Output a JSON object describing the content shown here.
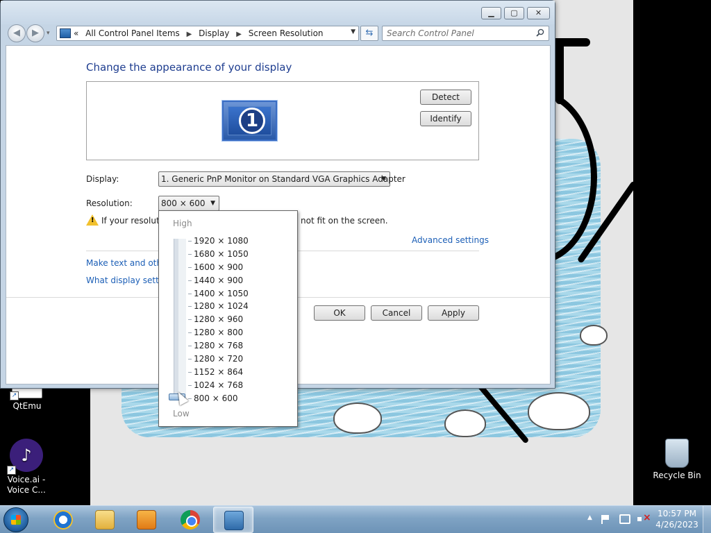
{
  "window": {
    "breadcrumb": [
      "All Control Panel Items",
      "Display",
      "Screen Resolution"
    ],
    "breadcrumb_prefix": "«",
    "search_placeholder": "Search Control Panel",
    "page_title": "Change the appearance of your display",
    "detect_label": "Detect",
    "identify_label": "Identify",
    "monitor_number": "1",
    "display_label": "Display:",
    "display_value": "1. Generic PnP Monitor on Standard VGA Graphics Adapter",
    "resolution_label": "Resolution:",
    "resolution_value": "800 × 600",
    "warning_text": "If your resolutio",
    "warning_text_tail": "not fit on the screen.",
    "advanced_settings": "Advanced settings",
    "link_text_size": "Make text and other",
    "link_display_settings": "What display setting",
    "ok_label": "OK",
    "cancel_label": "Cancel",
    "apply_label": "Apply"
  },
  "resolution_dropdown": {
    "high_label": "High",
    "low_label": "Low",
    "options": [
      "1920 × 1080",
      "1680 × 1050",
      "1600 × 900",
      "1440 × 900",
      "1400 × 1050",
      "1280 × 1024",
      "1280 × 960",
      "1280 × 800",
      "1280 × 768",
      "1280 × 720",
      "1152 × 864",
      "1024 × 768",
      "800 × 600"
    ],
    "selected": "800 × 600"
  },
  "desktop": {
    "icons": [
      {
        "label": "QtEmu"
      },
      {
        "label_line1": "Voice.ai -",
        "label_line2": "Voice C..."
      },
      {
        "label": "Recycle Bin"
      }
    ]
  },
  "taskbar": {
    "time": "10:57 PM",
    "date": "4/26/2023"
  },
  "colors": {
    "title_blue": "#1e3d8f",
    "link_blue": "#1b5eb6",
    "taskbar": "#7fa3c4"
  }
}
